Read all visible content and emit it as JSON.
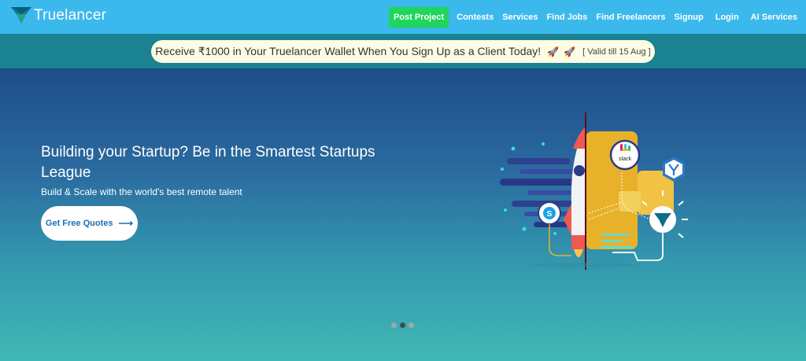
{
  "header": {
    "logo_text": "Truelancer",
    "nav": [
      {
        "label": "Post Project"
      },
      {
        "label": "Contests"
      },
      {
        "label": "Services"
      },
      {
        "label": "Find Jobs"
      },
      {
        "label": "Find Freelancers"
      },
      {
        "label": "Signup"
      },
      {
        "label": "Login"
      },
      {
        "label": "AI Services"
      }
    ],
    "colors": {
      "bar": "#3cb9ec",
      "post_project": "#1fd55c"
    }
  },
  "promo": {
    "text": "Receive ₹1000 in Your Truelancer Wallet When You Sign Up as a Client Today!",
    "rocket": "🚀",
    "valid": "[ Valid till 15 Aug ]"
  },
  "hero": {
    "title": "Building your Startup? Be in the Smartest Startups League",
    "subtitle": "Build & Scale with the world's best remote talent",
    "cta": {
      "label": "Get Free Quotes",
      "arrow": "⟶"
    },
    "illustration": {
      "slack_label": "slack",
      "icons": [
        "rocket-icon",
        "slack-icon",
        "skype-icon",
        "jira-icon",
        "truelancer-icon"
      ]
    },
    "carousel": {
      "count": 3,
      "active": 2
    }
  }
}
